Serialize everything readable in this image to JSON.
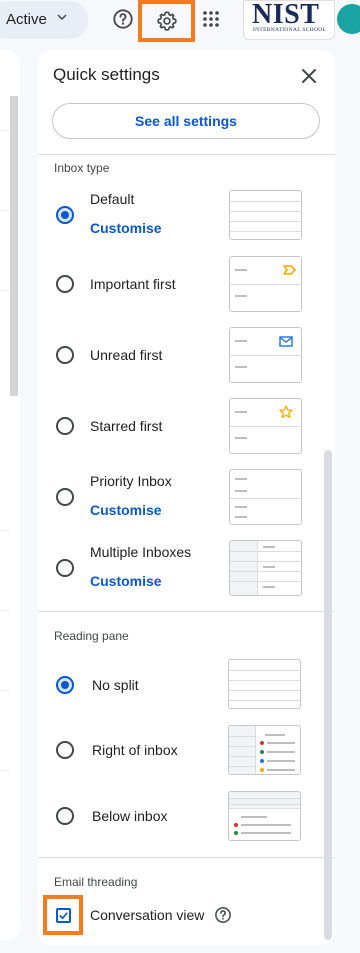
{
  "topbar": {
    "status_label": "Active",
    "status_color": "#1e8e3e",
    "help_icon": "help-circle-icon",
    "settings_icon": "gear-icon",
    "apps_icon": "apps-grid-icon",
    "logo_text": "NIST",
    "logo_subtext": "INTERNATIONAL SCHOOL"
  },
  "panel": {
    "title": "Quick settings",
    "close_icon": "close-icon",
    "see_all_label": "See all settings",
    "inbox_type": {
      "label": "Inbox type",
      "options": [
        {
          "label": "Default",
          "customise": "Customise",
          "selected": true
        },
        {
          "label": "Important first",
          "selected": false,
          "thumb_icon": "important-marker-icon"
        },
        {
          "label": "Unread first",
          "selected": false,
          "thumb_icon": "envelope-icon"
        },
        {
          "label": "Starred first",
          "selected": false,
          "thumb_icon": "star-icon"
        },
        {
          "label": "Priority Inbox",
          "customise": "Customise",
          "selected": false
        },
        {
          "label": "Multiple Inboxes",
          "customise": "Customise",
          "selected": false
        }
      ]
    },
    "reading_pane": {
      "label": "Reading pane",
      "options": [
        {
          "label": "No split",
          "selected": true
        },
        {
          "label": "Right of inbox",
          "selected": false
        },
        {
          "label": "Below inbox",
          "selected": false
        }
      ]
    },
    "threading": {
      "label": "Email threading",
      "conversation_view_label": "Conversation view",
      "conversation_view_checked": true,
      "help_icon": "help-circle-icon"
    }
  },
  "colors": {
    "accent_blue": "#0b57d0",
    "highlight_orange": "#f47c20",
    "important_yellow": "#f9ab00",
    "dot_red": "#d93025",
    "dot_green": "#1e8e3e",
    "dot_blue": "#1a73e8",
    "dot_yellow": "#f9ab00"
  }
}
